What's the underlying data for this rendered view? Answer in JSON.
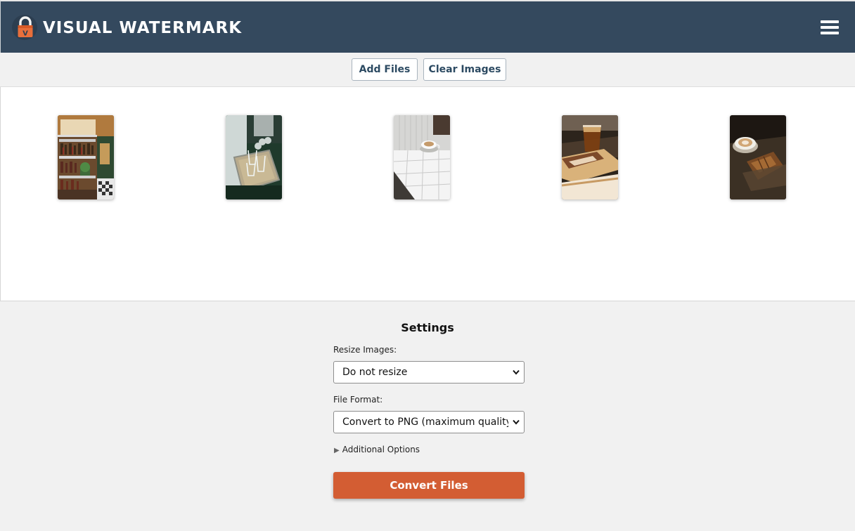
{
  "header": {
    "title": "VISUAL WATERMARK",
    "logo_icon": "padlock-v-icon",
    "logo_letter": "V",
    "menu_icon": "hamburger-menu-icon",
    "background": "#34495e"
  },
  "toolbar": {
    "add_files_label": "Add Files",
    "clear_images_label": "Clear Images"
  },
  "gallery": {
    "images": [
      {
        "name": "thumbnail-bar-shelves"
      },
      {
        "name": "thumbnail-glasses-tray"
      },
      {
        "name": "thumbnail-coffee-cup-tiles"
      },
      {
        "name": "thumbnail-iced-coffee-cake"
      },
      {
        "name": "thumbnail-cappuccino-croissant"
      }
    ]
  },
  "settings": {
    "title": "Settings",
    "resize_label": "Resize Images:",
    "resize_value": "Do not resize",
    "format_label": "File Format:",
    "format_value": "Convert to PNG (maximum quality, larger file size)",
    "additional_options_label": "Additional Options",
    "convert_label": "Convert Files"
  },
  "colors": {
    "accent": "#d35d33",
    "button_text": "#2c4a62"
  }
}
